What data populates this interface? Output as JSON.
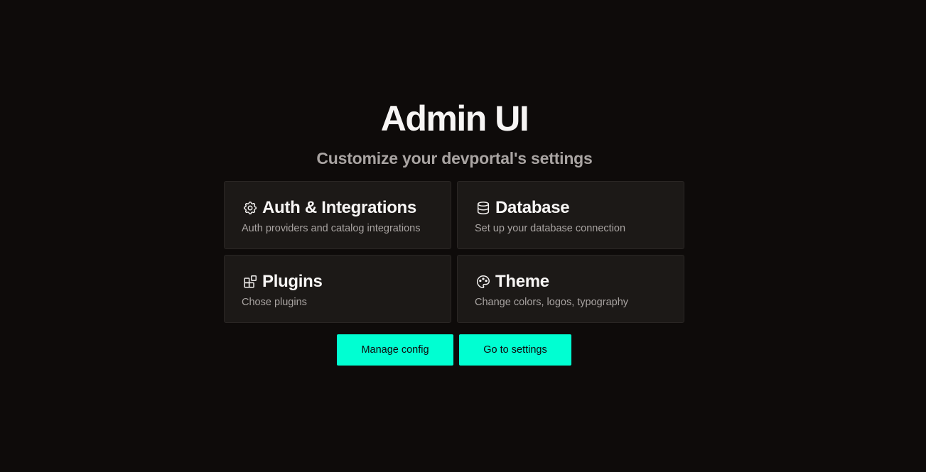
{
  "header": {
    "title": "Admin UI",
    "subtitle": "Customize your devportal's settings"
  },
  "cards": [
    {
      "icon": "gear-icon",
      "title": "Auth & Integrations",
      "description": "Auth providers and catalog integrations"
    },
    {
      "icon": "database-icon",
      "title": "Database",
      "description": "Set up your database connection"
    },
    {
      "icon": "plugins-icon",
      "title": "Plugins",
      "description": "Chose plugins"
    },
    {
      "icon": "palette-icon",
      "title": "Theme",
      "description": "Change colors, logos, typography"
    }
  ],
  "actions": {
    "manage_label": "Manage config",
    "settings_label": "Go to settings"
  },
  "colors": {
    "background": "#0e0b0a",
    "card": "#1c1917",
    "accent": "#00ffd2",
    "muted_text": "#a9a4a2"
  }
}
